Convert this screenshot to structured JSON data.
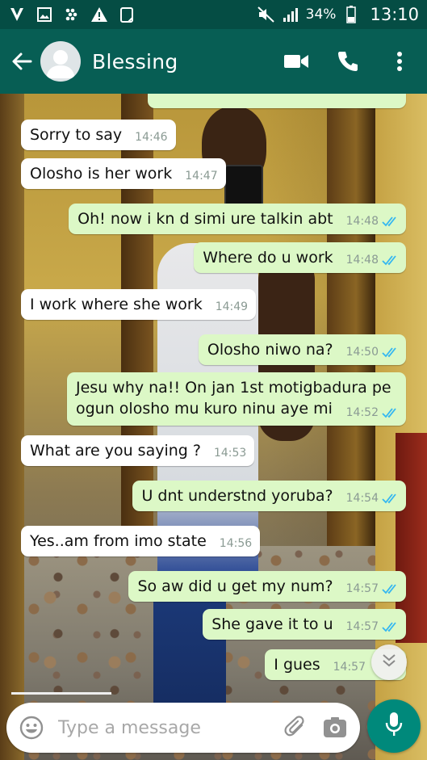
{
  "status_bar": {
    "battery": "34%",
    "time": "13:10"
  },
  "header": {
    "contact_name": "Blessing"
  },
  "messages": [
    {
      "dir": "out",
      "text": "",
      "time": "",
      "partial": true
    },
    {
      "dir": "in",
      "text": "Sorry to say",
      "time": "14:46"
    },
    {
      "dir": "in",
      "text": "Olosho is her work",
      "time": "14:47"
    },
    {
      "dir": "out",
      "text": "Oh! now i kn d simi ure talkin abt",
      "time": "14:48",
      "read": true
    },
    {
      "dir": "out",
      "text": "Where do u work",
      "time": "14:48",
      "read": true
    },
    {
      "dir": "in",
      "text": "I work where she work",
      "time": "14:49"
    },
    {
      "dir": "out",
      "text": "Olosho niwo na?",
      "time": "14:50",
      "read": true
    },
    {
      "dir": "out",
      "text": "Jesu why na!! On jan 1st motigbadura pe ogun olosho mu kuro ninu aye mi",
      "time": "14:52",
      "read": true
    },
    {
      "dir": "in",
      "text": "What are you saying ?",
      "time": "14:53"
    },
    {
      "dir": "out",
      "text": "U dnt understnd yoruba?",
      "time": "14:54",
      "read": true
    },
    {
      "dir": "in",
      "text": "Yes..am from imo state",
      "time": "14:56"
    },
    {
      "dir": "out",
      "text": "So aw did u get my num?",
      "time": "14:57",
      "read": true
    },
    {
      "dir": "out",
      "text": "She gave it to u",
      "time": "14:57",
      "read": true
    },
    {
      "dir": "out",
      "text": "I gues",
      "time": "14:57",
      "read": false
    }
  ],
  "composer": {
    "placeholder": "Type a message"
  },
  "colors": {
    "header": "#075e54",
    "status_bar": "#054d44",
    "outgoing_bubble": "#dcf8c6",
    "incoming_bubble": "#ffffff",
    "read_tick": "#34b7f1",
    "mic_button": "#00897b"
  },
  "icons": {
    "status_left": [
      "whatsapp-icon",
      "gallery-icon",
      "blackberry-icon",
      "warning-icon",
      "clipboard-icon"
    ],
    "status_right": [
      "mute-icon",
      "signal-icon",
      "battery-icon"
    ],
    "header": [
      "back-arrow-icon",
      "video-call-icon",
      "phone-call-icon",
      "more-vert-icon"
    ],
    "composer": [
      "emoji-icon",
      "attach-icon",
      "camera-icon",
      "mic-icon"
    ],
    "scroll": "double-chevron-down-icon"
  }
}
